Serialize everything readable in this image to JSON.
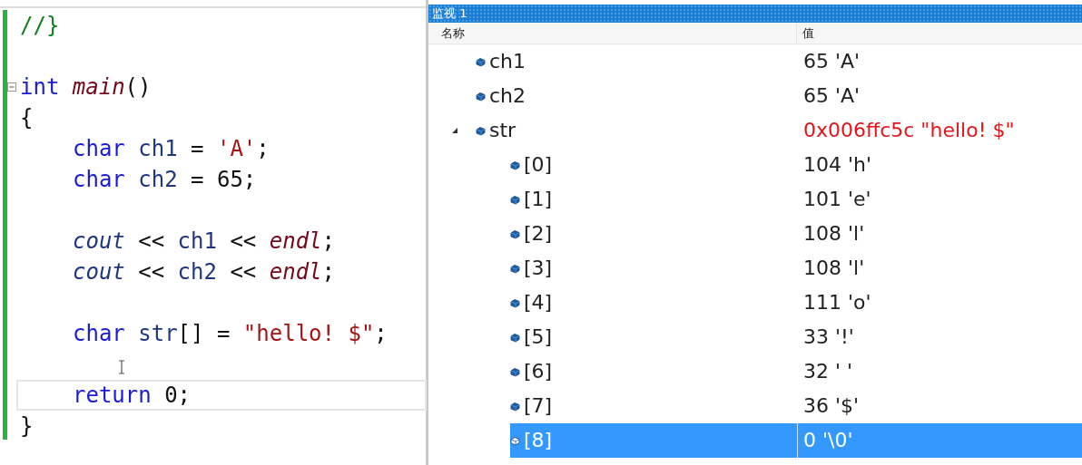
{
  "editor": {
    "lines": [
      {
        "foldable": false,
        "current": false,
        "indented": false,
        "tokens": [
          {
            "kind": "comment",
            "text": "//}"
          }
        ]
      },
      {
        "foldable": false,
        "current": false
      },
      {
        "foldable": true,
        "current": false,
        "indented": false,
        "tokens": [
          {
            "kind": "keyword",
            "text": "int"
          },
          {
            "kind": "func",
            "text": " main"
          },
          {
            "kind": "plain",
            "text": "()"
          }
        ]
      },
      {
        "foldable": false,
        "current": false,
        "indented": false,
        "tokens": [
          {
            "kind": "plain",
            "text": "{"
          }
        ]
      },
      {
        "foldable": false,
        "current": false,
        "indented": true,
        "tokens": [
          {
            "kind": "keyword",
            "text": "char"
          },
          {
            "kind": "variable",
            "text": " ch1"
          },
          {
            "kind": "plain",
            "text": " = "
          },
          {
            "kind": "string",
            "text": "'A'"
          },
          {
            "kind": "plain",
            "text": ";"
          }
        ]
      },
      {
        "foldable": false,
        "current": false,
        "indented": true,
        "tokens": [
          {
            "kind": "keyword",
            "text": "char"
          },
          {
            "kind": "variable",
            "text": " ch2"
          },
          {
            "kind": "plain",
            "text": " = 65;"
          }
        ]
      },
      {
        "foldable": false,
        "current": false
      },
      {
        "foldable": false,
        "current": false,
        "indented": true,
        "tokens": [
          {
            "kind": "global",
            "text": "cout"
          },
          {
            "kind": "plain",
            "text": " << "
          },
          {
            "kind": "variable",
            "text": "ch1"
          },
          {
            "kind": "plain",
            "text": " << "
          },
          {
            "kind": "func",
            "text": "endl"
          },
          {
            "kind": "plain",
            "text": ";"
          }
        ]
      },
      {
        "foldable": false,
        "current": false,
        "indented": true,
        "tokens": [
          {
            "kind": "global",
            "text": "cout"
          },
          {
            "kind": "plain",
            "text": " << "
          },
          {
            "kind": "variable",
            "text": "ch2"
          },
          {
            "kind": "plain",
            "text": " << "
          },
          {
            "kind": "func",
            "text": "endl"
          },
          {
            "kind": "plain",
            "text": ";"
          }
        ]
      },
      {
        "foldable": false,
        "current": false
      },
      {
        "foldable": false,
        "current": false,
        "indented": true,
        "tokens": [
          {
            "kind": "keyword",
            "text": "char"
          },
          {
            "kind": "variable",
            "text": " str"
          },
          {
            "kind": "plain",
            "text": "[] = "
          },
          {
            "kind": "string",
            "text": "\"hello! $\""
          },
          {
            "kind": "plain",
            "text": ";"
          }
        ]
      },
      {
        "foldable": false,
        "current": false
      },
      {
        "foldable": false,
        "current": true,
        "indented": true,
        "tokens": [
          {
            "kind": "keyword",
            "text": "return"
          },
          {
            "kind": "plain",
            "text": " 0;"
          }
        ]
      },
      {
        "foldable": false,
        "current": false,
        "indented": false,
        "tokens": [
          {
            "kind": "plain",
            "text": "}"
          }
        ]
      }
    ]
  },
  "watch": {
    "title": "监视 1",
    "columns": [
      "名称",
      "值"
    ],
    "rows": [
      {
        "name": "ch1",
        "value": "65 'A'",
        "changed": false,
        "selected": false
      },
      {
        "name": "ch2",
        "value": "65 'A'",
        "changed": false,
        "selected": false
      },
      {
        "name": "str",
        "value": "0x006ffc5c \"hello! $\"",
        "changed": true,
        "selected": false,
        "expanded": true,
        "children": [
          {
            "name": "[0]",
            "value": "104 'h'",
            "changed": false,
            "selected": false
          },
          {
            "name": "[1]",
            "value": "101 'e'",
            "changed": false,
            "selected": false
          },
          {
            "name": "[2]",
            "value": "108 'l'",
            "changed": false,
            "selected": false
          },
          {
            "name": "[3]",
            "value": "108 'l'",
            "changed": false,
            "selected": false
          },
          {
            "name": "[4]",
            "value": "111 'o'",
            "changed": false,
            "selected": false
          },
          {
            "name": "[5]",
            "value": "33 '!'",
            "changed": false,
            "selected": false
          },
          {
            "name": "[6]",
            "value": "32 ' '",
            "changed": false,
            "selected": false
          },
          {
            "name": "[7]",
            "value": "36 '$'",
            "changed": false,
            "selected": false
          },
          {
            "name": "[8]",
            "value": "0 '\\0'",
            "changed": false,
            "selected": true
          }
        ]
      }
    ]
  }
}
